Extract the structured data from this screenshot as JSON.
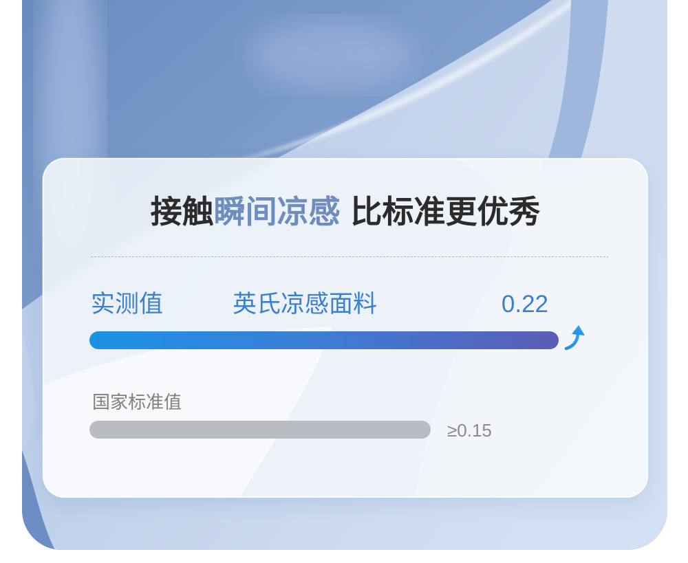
{
  "chart_data": {
    "type": "bar",
    "orientation": "horizontal",
    "title": {
      "lead": "接触",
      "highlight": "瞬间凉感",
      "tail": "比标准更优秀"
    },
    "categories": [
      "实测值",
      "国家标准值"
    ],
    "sublabels": [
      "英氏凉感面料",
      ""
    ],
    "values": [
      0.22,
      0.15
    ],
    "data_labels": [
      "0.22",
      "≥0.15"
    ],
    "grid": false,
    "axes_visible": false
  },
  "icons": {
    "measured_trend": "curved-arrow-up-icon"
  },
  "colors": {
    "title_dark": "#2b2b2b",
    "title_highlight": "#6e8cbd",
    "measured_text": "#3a80d2",
    "measured_bar_start": "#1a92e5",
    "measured_bar_end": "#5b5db5",
    "measured_arrow": "#1f8fe2",
    "standard_text": "#7f7f7f",
    "standard_value_text": "#8a8a8a",
    "standard_bar": "#b9bcc0",
    "divider": "#a2b3d0"
  }
}
